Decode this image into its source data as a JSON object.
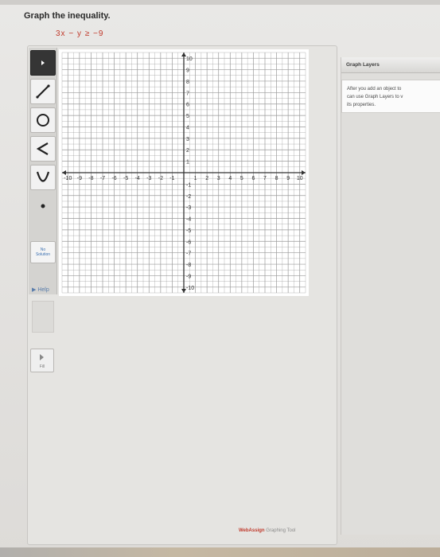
{
  "question": {
    "title": "Graph the inequality.",
    "inequality": "3x − y ≥ −9"
  },
  "toolbar": {
    "tools": [
      {
        "icon": "pointer-icon",
        "active": true
      },
      {
        "icon": "line-icon",
        "active": false
      },
      {
        "icon": "circle-icon",
        "active": false
      },
      {
        "icon": "angle-icon",
        "active": false
      },
      {
        "icon": "parabola-icon",
        "active": false
      },
      {
        "icon": "point-icon",
        "active": false
      }
    ],
    "no_solution_line1": "No",
    "no_solution_line2": "Solution",
    "help_label": "Help",
    "fill_label": "Fill"
  },
  "graph": {
    "x_min": -10,
    "x_max": 10,
    "y_min": -10,
    "y_max": 10,
    "x_ticks": [
      "-10",
      "-9",
      "-8",
      "-7",
      "-6",
      "-5",
      "-4",
      "-3",
      "-2",
      "-1",
      "1",
      "2",
      "3",
      "4",
      "5",
      "6",
      "7",
      "8",
      "9",
      "10"
    ],
    "y_ticks": [
      "10",
      "9",
      "8",
      "7",
      "6",
      "5",
      "4",
      "3",
      "2",
      "1",
      "-1",
      "-2",
      "-3",
      "-4",
      "-5",
      "-6",
      "-7",
      "-8",
      "-9",
      "-10"
    ],
    "grid": true
  },
  "layers_panel": {
    "title": "Graph Layers",
    "text_line1": "After you add an object to",
    "text_line2": "can use Graph Layers to v",
    "text_line3": "its properties."
  },
  "footer": {
    "brand": "WebAssign",
    "tool_name": "Graphing Tool"
  },
  "colors": {
    "accent": "#c0392b",
    "grid_line": "#9a9a9a",
    "axis": "#333333",
    "link": "#3a6fb0"
  }
}
